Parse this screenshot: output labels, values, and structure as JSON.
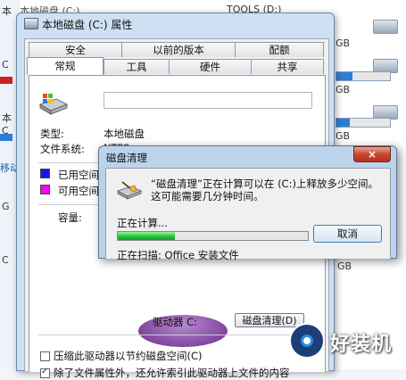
{
  "background": {
    "drive_c_label": "本地磁盘 (C:)",
    "tools_label": "TOOLS (D:)",
    "gb_1": "GB",
    "gb_2": "GB",
    "gb_3": "GB",
    "gb_4": "GB",
    "gb_5": "GB",
    "left_fragments": [
      "本",
      "C",
      "本",
      "C",
      "移动",
      "G",
      "C"
    ]
  },
  "properties": {
    "title": "本地磁盘 (C:) 属性",
    "tabs_row1": [
      "安全",
      "以前的版本",
      "配额"
    ],
    "tabs_row2": [
      "常规",
      "工具",
      "硬件",
      "共享"
    ],
    "type_label": "类型:",
    "type_value": "本地磁盘",
    "fs_label": "文件系统:",
    "fs_value": "NTFS",
    "used_label": "已用空间",
    "free_label": "可用空间",
    "capacity_label": "容量:",
    "drive_label": "驱动器 C:",
    "cleanup_button": "磁盘清理(D)",
    "compress_label": "压缩此驱动器以节约磁盘空间(C)",
    "index_label": "除了文件属性外，还允许索引此驱动器上文件的内容",
    "compress_checked": false,
    "index_checked": true,
    "colors": {
      "used": "#1515e8",
      "free": "#f00af0"
    }
  },
  "cleanup": {
    "title": "磁盘清理",
    "close_symbol": "×",
    "message": "“磁盘清理”正在计算可以在 (C:)上释放多少空间。这可能需要几分钟时间。",
    "calculating": "正在计算...",
    "progress": 0.3,
    "cancel": "取消",
    "scanning": "正在扫描:   Office 安装文件"
  },
  "watermark": {
    "text": "好装机"
  }
}
